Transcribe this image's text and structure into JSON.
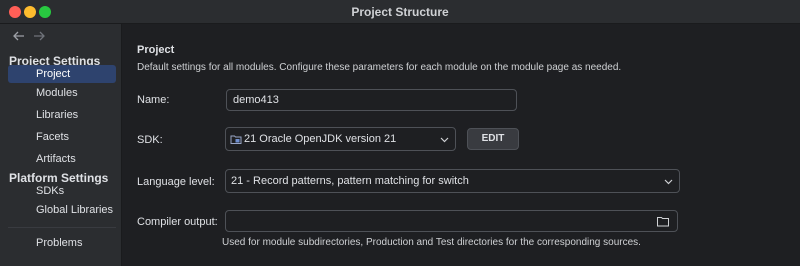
{
  "window": {
    "title": "Project Structure"
  },
  "sidebar": {
    "nav": {
      "back_icon": "arrow-left-icon",
      "forward_icon": "arrow-right-icon"
    },
    "sections": [
      {
        "header": "Project Settings"
      },
      {
        "header": "Platform Settings"
      }
    ],
    "items": [
      {
        "label": "Project",
        "selected": true
      },
      {
        "label": "Modules"
      },
      {
        "label": "Libraries"
      },
      {
        "label": "Facets"
      },
      {
        "label": "Artifacts"
      },
      {
        "label": "SDKs"
      },
      {
        "label": "Global Libraries"
      },
      {
        "label": "Problems"
      }
    ]
  },
  "main": {
    "title": "Project",
    "description": "Default settings for all modules. Configure these parameters for each module on the module page as needed.",
    "name": {
      "label": "Name:",
      "value": "demo413"
    },
    "sdk": {
      "label": "SDK:",
      "value": "21 Oracle OpenJDK version 21",
      "edit_label": "EDIT"
    },
    "language_level": {
      "label": "Language level:",
      "value": "21 - Record patterns, pattern matching for switch"
    },
    "compiler_output": {
      "label": "Compiler output:",
      "value": "",
      "hint": "Used for module subdirectories, Production and Test directories for the corresponding sources."
    }
  },
  "colors": {
    "selection": "#2e436e",
    "background": "#1e1f22",
    "panel": "#2b2d30",
    "border": "#4e5157"
  }
}
